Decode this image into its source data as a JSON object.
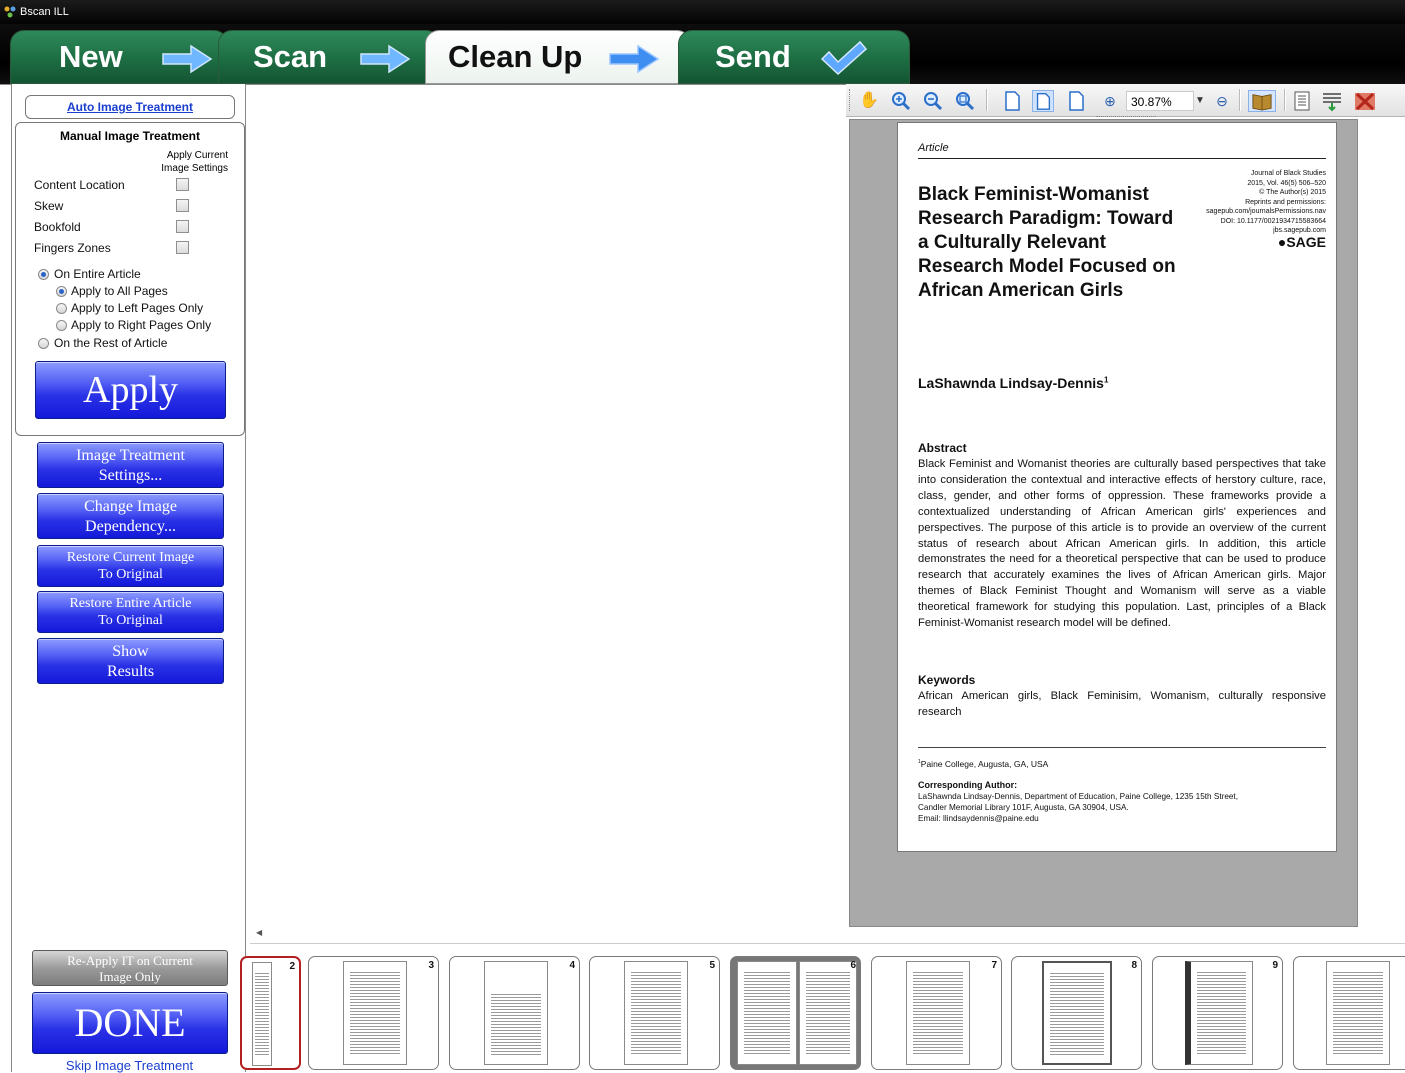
{
  "window": {
    "title": "Bscan ILL"
  },
  "tabs": [
    {
      "label": "New"
    },
    {
      "label": "Scan"
    },
    {
      "label": "Clean Up"
    },
    {
      "label": "Send"
    }
  ],
  "left_panel": {
    "auto_link": "Auto Image Treatment",
    "manual_title": "Manual Image Treatment",
    "apply_current_header_1": "Apply Current",
    "apply_current_header_2": "Image Settings",
    "options": [
      {
        "label": "Content Location"
      },
      {
        "label": "Skew"
      },
      {
        "label": "Bookfold"
      },
      {
        "label": "Fingers Zones"
      }
    ],
    "radio_entire": "On Entire Article",
    "radio_all": "Apply to All Pages",
    "radio_left": "Apply to Left Pages Only",
    "radio_right": "Apply to Right Pages Only",
    "radio_rest": "On the Rest of Article",
    "apply_button": "Apply",
    "buttons": {
      "it_settings_1": "Image Treatment",
      "it_settings_2": "Settings...",
      "change_dep_1": "Change Image",
      "change_dep_2": "Dependency...",
      "restore_current_1": "Restore Current Image",
      "restore_current_2": "To Original",
      "restore_entire_1": "Restore Entire Article",
      "restore_entire_2": "To Original",
      "show_results_1": "Show",
      "show_results_2": "Results"
    },
    "reapply_1": "Re-Apply IT on Current",
    "reapply_2": "Image Only",
    "done": "DONE",
    "skip": "Skip Image Treatment"
  },
  "toolbar": {
    "zoom": "30.87%",
    "icons": [
      "hand-icon",
      "zoom-in-icon",
      "zoom-out-icon",
      "zoom-fit-icon",
      "single-page-icon",
      "fit-page-icon",
      "fit-width-icon",
      "zoom-plus-icon",
      "zoom-minus-icon",
      "book-icon",
      "list-icon",
      "sort-icon",
      "delete-icon"
    ]
  },
  "document": {
    "section": "Article",
    "journal": "Journal of Black Studies",
    "volume": "2015, Vol. 46(5) 506–520",
    "copyright": "© The Author(s) 2015",
    "reprints": "Reprints and permissions:",
    "reprints_url": "sagepub.com/journalsPermissions.nav",
    "doi": "DOI: 10.1177/0021934715583664",
    "site": "jbs.sagepub.com",
    "publisher": "SAGE",
    "title": "Black Feminist-Womanist Research Paradigm: Toward a Culturally Relevant Research Model Focused on African American Girls",
    "author": "LaShawnda Lindsay-Dennis",
    "abstract_heading": "Abstract",
    "abstract": "Black Feminist and Womanist theories are culturally based perspectives that take into consideration the contextual and interactive effects of herstory culture, race, class, gender, and other forms of oppression. These frameworks provide a contextualized understanding of African American girls' experiences and perspectives. The purpose of this article is to provide an overview of the current status of research about African American girls. In addition, this article demonstrates the need for a theoretical perspective that can be used to produce research that accurately examines the lives of African American girls. Major themes of Black Feminist Thought and Womanism will serve as a viable theoretical framework for studying this population. Last, principles of a Black Feminist-Womanist research model will be defined.",
    "keywords_heading": "Keywords",
    "keywords": "African American girls, Black Feminisim, Womanism, culturally responsive research",
    "affiliation": "Paine College, Augusta, GA, USA",
    "corresponding_heading": "Corresponding Author:",
    "corresponding_1": "LaShawnda Lindsay-Dennis, Department of Education, Paine College, 1235 15th Street,",
    "corresponding_2": "Candler Memorial Library 101F, Augusta, GA 30904, USA.",
    "email": "Email: llindsaydennis@paine.edu"
  },
  "thumbnails": [
    {
      "number": "2"
    },
    {
      "number": "3"
    },
    {
      "number": "4"
    },
    {
      "number": "5"
    },
    {
      "number": "6"
    },
    {
      "number": "7"
    },
    {
      "number": "8"
    },
    {
      "number": "9"
    },
    {
      "number": ""
    }
  ]
}
